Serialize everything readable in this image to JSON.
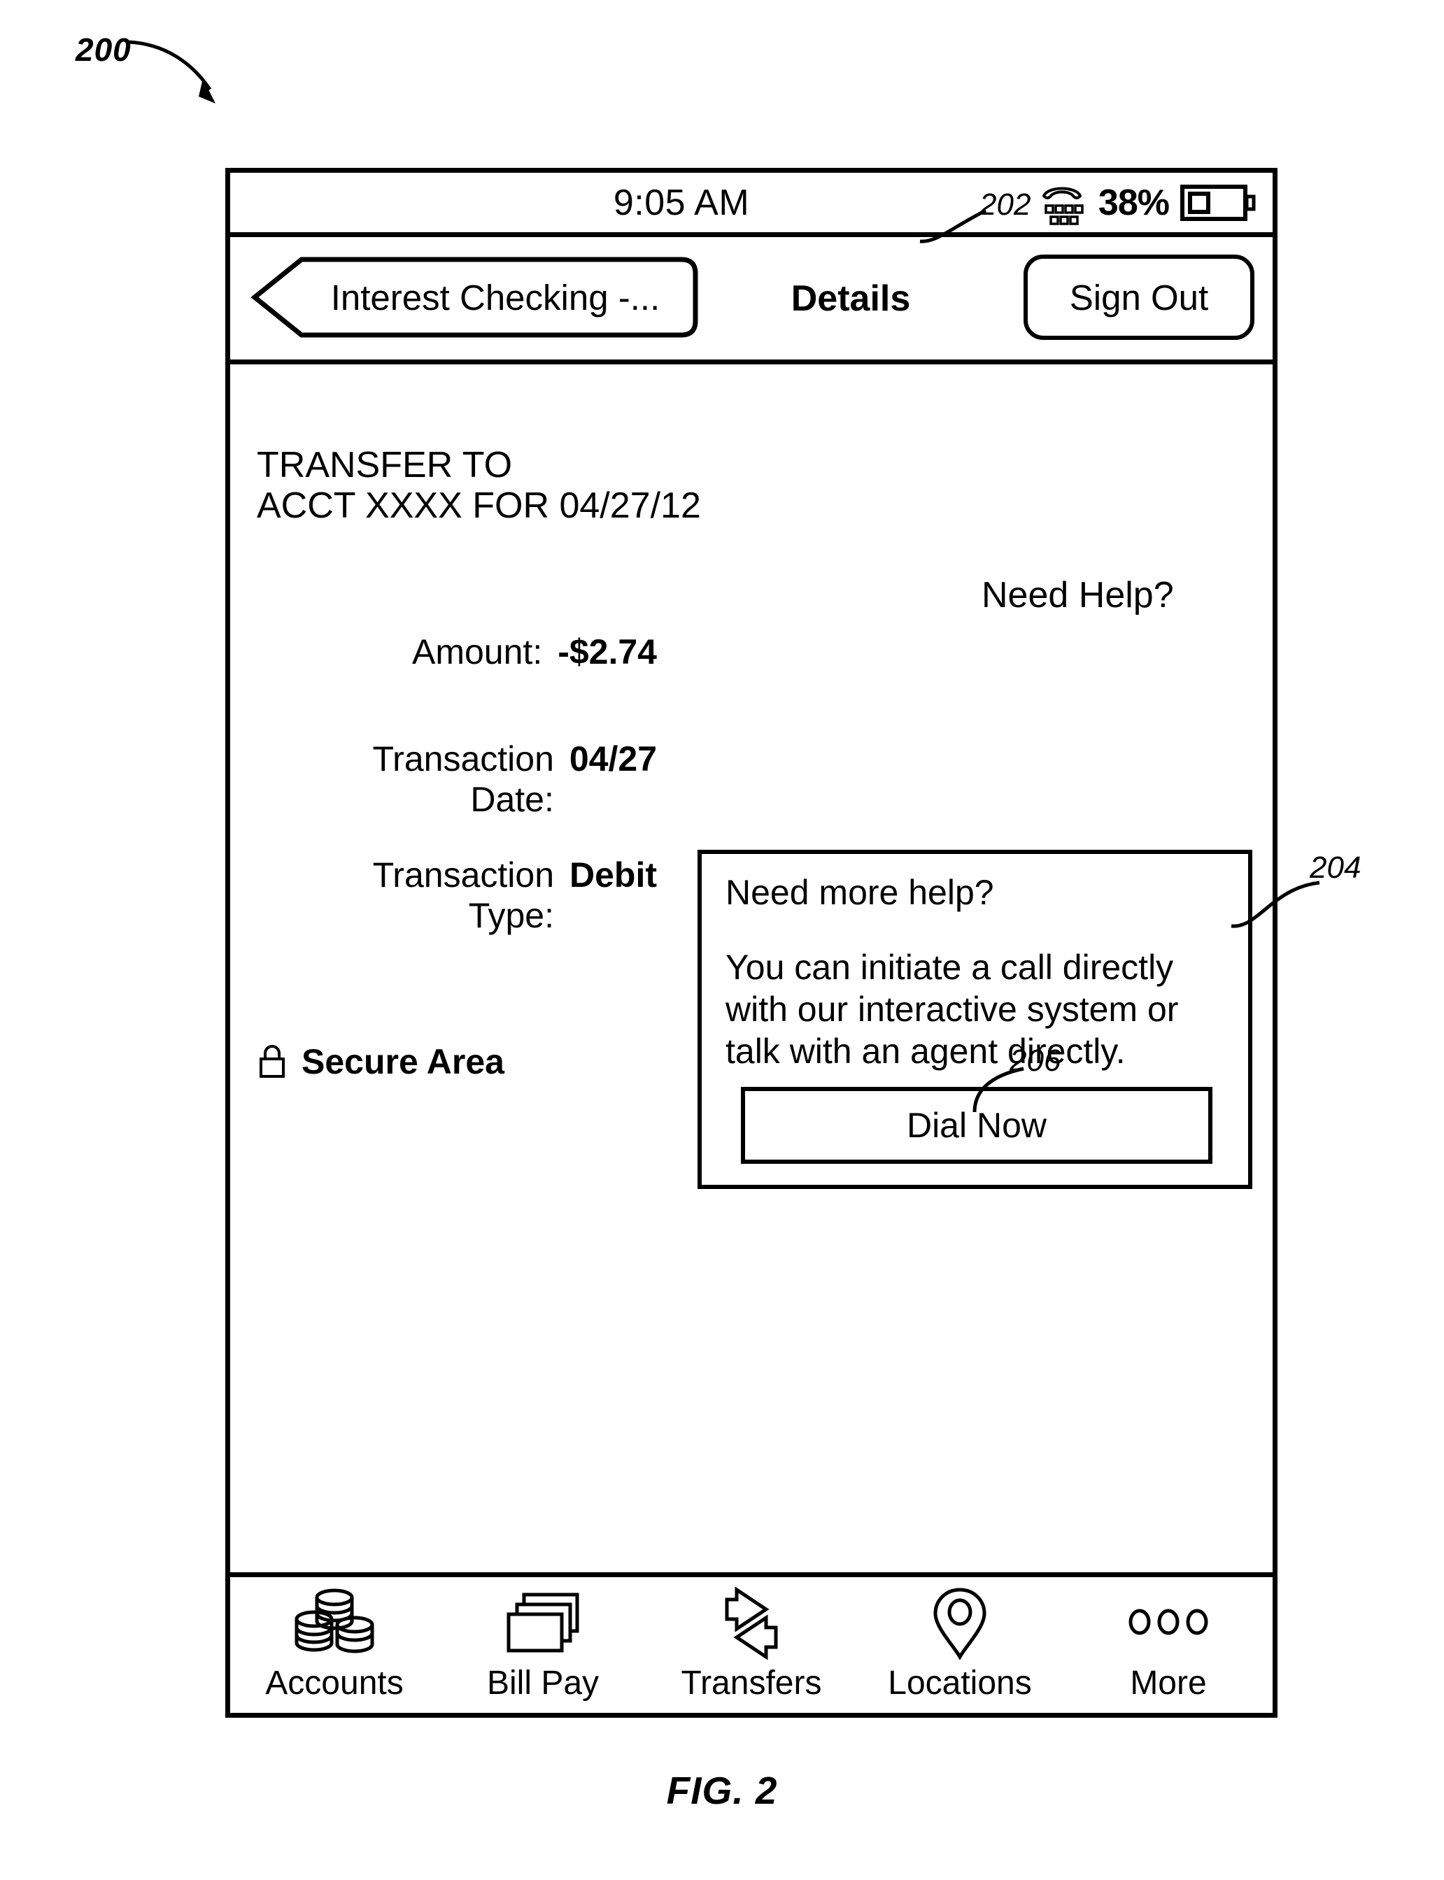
{
  "figure": {
    "device_ref": "200",
    "caption": "FIG. 2",
    "ref_help_link": "202",
    "ref_help_panel": "204",
    "ref_dial_button": "206"
  },
  "status_bar": {
    "time": "9:05 AM",
    "battery_percent": "38%",
    "phone_icon": "phone-keypad-icon",
    "battery_icon": "battery-icon"
  },
  "nav_bar": {
    "back_label": "Interest Checking -...",
    "back_icon": "chevron-left-icon",
    "title": "Details",
    "sign_out_label": "Sign Out"
  },
  "transaction": {
    "title": "TRANSFER TO\nACCT XXXX FOR 04/27/12",
    "rows": [
      {
        "label": "Amount:",
        "value": "-$2.74"
      },
      {
        "label": "Transaction Date:",
        "value": "04/27"
      },
      {
        "label": "Transaction Type:",
        "value": "Debit"
      }
    ],
    "secure_area_label": "Secure Area",
    "secure_area_icon": "lock-icon"
  },
  "help": {
    "link_label": "Need Help?",
    "panel_heading": "Need more help?",
    "panel_body": "You can initiate a call directly with our interactive system or talk with an agent directly.",
    "dial_button_label": "Dial Now"
  },
  "tab_bar": {
    "items": [
      {
        "label": "Accounts",
        "icon": "coins-icon"
      },
      {
        "label": "Bill Pay",
        "icon": "documents-icon"
      },
      {
        "label": "Transfers",
        "icon": "two-arrows-icon"
      },
      {
        "label": "Locations",
        "icon": "map-pin-icon"
      },
      {
        "label": "More",
        "icon": "ellipsis-icon"
      }
    ]
  },
  "colors": {
    "line": "#000000",
    "background": "#ffffff"
  }
}
